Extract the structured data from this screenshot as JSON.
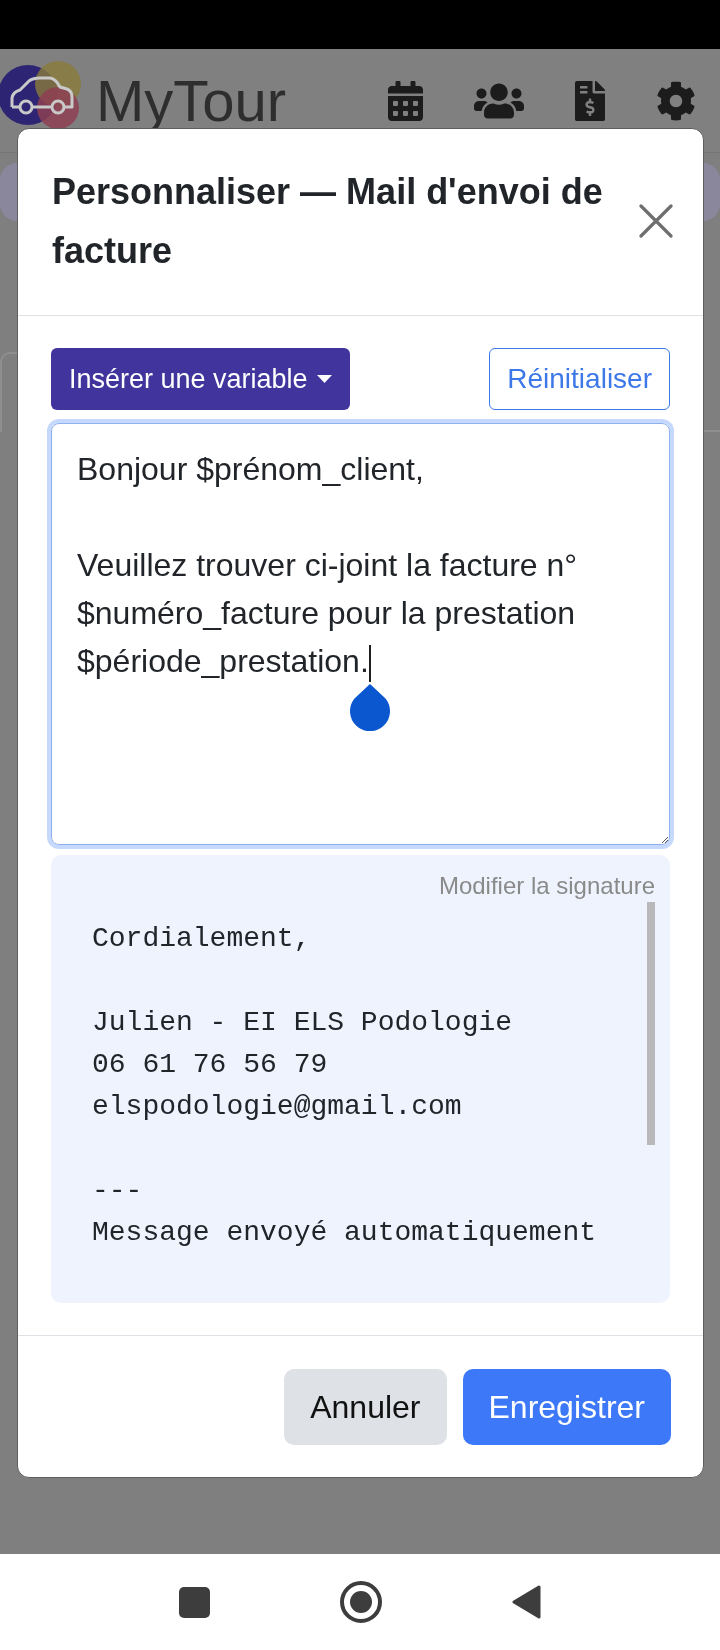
{
  "app_header": {
    "logo_text": "MyTour"
  },
  "dialog": {
    "title": "Personnaliser — Mail d'envoi de facture",
    "insert_variable_button": {
      "label": "Insérer une variable"
    },
    "reset_button": {
      "label": "Réinitialiser"
    },
    "message_field": {
      "value": "Bonjour $prénom_client,\n\nVeuillez trouver ci-joint la facture n° $numéro_facture pour la prestation $période_prestation.",
      "focused": true
    },
    "signature": {
      "edit_link": "Modifier la signature",
      "text": "Cordialement,\n\nJulien - EI ELS Podologie\n06 61 76 56 79\nelspodologie@gmail.com\n\n---\nMessage envoyé automatiquement"
    },
    "footer_buttons": [
      {
        "label": "Annuler",
        "kind": "secondary"
      },
      {
        "label": "Enregistrer",
        "kind": "primary"
      }
    ]
  }
}
